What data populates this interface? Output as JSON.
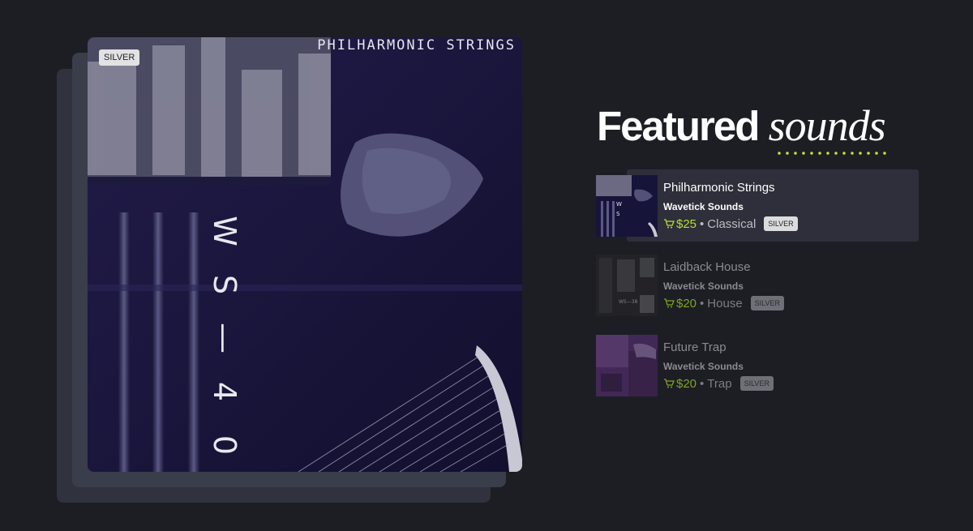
{
  "cover": {
    "title": "PHILHARMONIC STRINGS",
    "badge": "SILVER",
    "code": [
      "W",
      "S",
      "—",
      "4",
      "0"
    ]
  },
  "heading": {
    "bold": "Featured",
    "italic": "sounds"
  },
  "items": [
    {
      "name": "Philharmonic Strings",
      "label": "Wavetick Sounds",
      "price": "$25",
      "genre": "Classical",
      "badge": "SILVER"
    },
    {
      "name": "Laidback House",
      "label": "Wavetick Sounds",
      "price": "$20",
      "genre": "House",
      "badge": "SILVER"
    },
    {
      "name": "Future Trap",
      "label": "Wavetick Sounds",
      "price": "$20",
      "genre": "Trap",
      "badge": "SILVER"
    }
  ],
  "colors": {
    "background": "#1d1e24",
    "accent": "#b5e02e",
    "highlight": "#2e2f3a"
  },
  "icons": [
    "cart-icon"
  ]
}
